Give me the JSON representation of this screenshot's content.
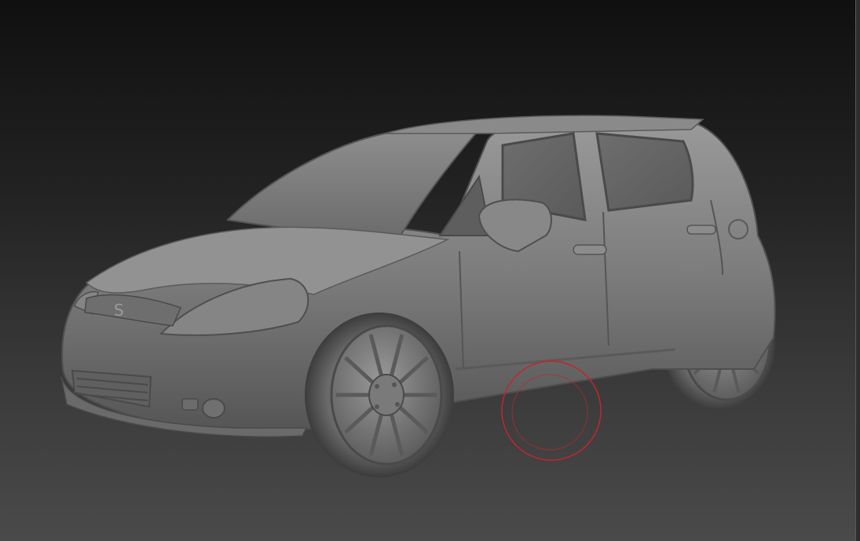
{
  "viewport": {
    "subject": "sculpted-car-model",
    "background_top": "#101010",
    "background_bottom": "#4a4a4a",
    "model_color": "#7a7a7a"
  },
  "brush": {
    "color": "#c0272d",
    "icon": "brush-cursor-icon"
  }
}
